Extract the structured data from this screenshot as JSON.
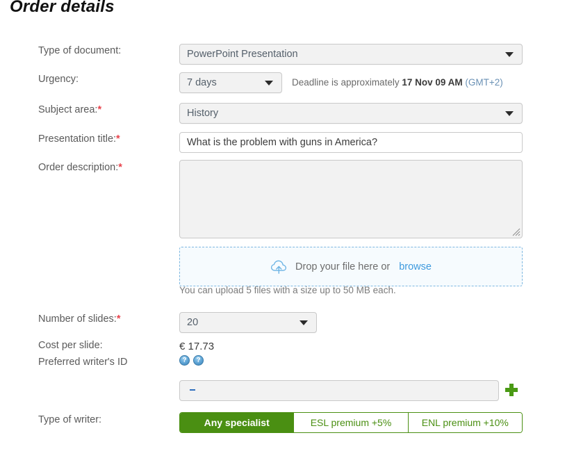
{
  "page": {
    "title": "Order details"
  },
  "fields": {
    "type_of_document": {
      "label": "Type of document:",
      "value": "PowerPoint Presentation",
      "required": false
    },
    "urgency": {
      "label": "Urgency:",
      "value": "7 days",
      "required": false,
      "deadline_prefix": "Deadline is approximately ",
      "deadline_value": "17 Nov 09 AM",
      "deadline_timezone": " (GMT+2)"
    },
    "subject_area": {
      "label": "Subject area:",
      "value": "History",
      "required": true,
      "required_mark": "*"
    },
    "presentation_title": {
      "label": "Presentation title:",
      "value": "What is the problem with guns in America?",
      "placeholder": "",
      "required": true,
      "required_mark": "*"
    },
    "order_description": {
      "label": "Order description:",
      "value": "",
      "placeholder": "",
      "required": true,
      "required_mark": "*"
    },
    "upload": {
      "drop_text": "Drop your file here or",
      "browse_label": "browse",
      "icon": "cloud-upload-icon",
      "hint": "You can upload 5 files with a size up to 50 MB each."
    },
    "number_of_slides": {
      "label": "Number of slides:",
      "value": "20",
      "required": true,
      "required_mark": "*"
    },
    "cost_per_slide": {
      "label": "Cost per slide:",
      "value": "€ 17.73"
    },
    "preferred_writer": {
      "label": "Preferred writer's ID",
      "value": "",
      "placeholder": "",
      "help_icon_1": "?",
      "help_icon_2": "?",
      "add_button_icon": "plus-icon"
    },
    "type_of_writer": {
      "label": "Type of writer:",
      "options": [
        {
          "label": "Any specialist",
          "active": true
        },
        {
          "label": "ESL premium +5%",
          "active": false
        },
        {
          "label": "ENL premium +10%",
          "active": false
        }
      ]
    }
  },
  "colors": {
    "accent_green": "#4a8f12",
    "link_blue": "#3e9ade",
    "required_red": "#e8434c",
    "field_grey": "#f2f2f2"
  }
}
